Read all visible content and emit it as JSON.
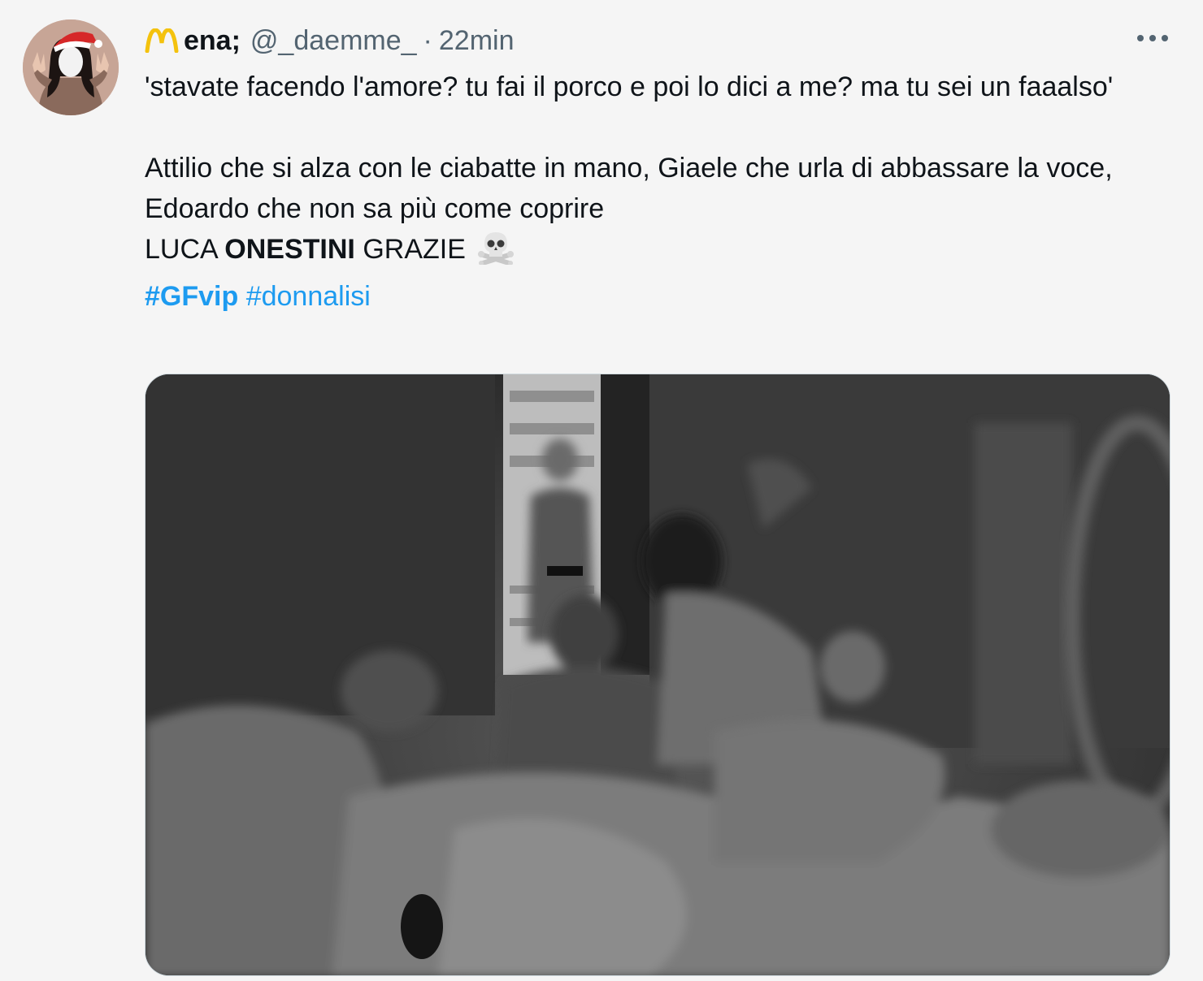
{
  "tweet": {
    "display_name": "ena;",
    "handle": "@_daemme_",
    "separator": "·",
    "time": "22min",
    "text_line1": "'stavate facendo l'amore? tu fai il porco e poi lo dici a me? ma tu sei un faaalso'",
    "text_line2": "Attilio che si alza con le ciabatte in mano, Giaele che urla di abbassare la voce, Edoardo che non sa più come coprire",
    "luca": "LUCA",
    "onestini": "ONESTINI",
    "grazie": "GRAZIE",
    "hashtags": [
      "#GFvip",
      "#donnalisi"
    ]
  },
  "icons": {
    "name_icon": "mcdonalds-arch-icon",
    "emoji": "skull-crossbones-icon",
    "more": "more-dots-icon"
  },
  "colors": {
    "background": "#f5f5f5",
    "text": "#0f1419",
    "secondary": "#536471",
    "hashtag": "#1d9bf0"
  }
}
